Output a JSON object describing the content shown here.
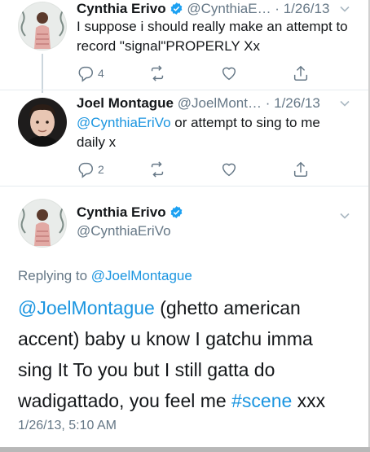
{
  "colors": {
    "link": "#1b95e0",
    "muted": "#657786",
    "verified": "#1da1f2"
  },
  "tweets": [
    {
      "name": "Cynthia Erivo",
      "verified": true,
      "handle": "@CynthiaE…",
      "date": "1/26/13",
      "text": "I suppose i should really make an attempt to record \"signal\"PROPERLY Xx",
      "replies": "4",
      "icons": [
        "reply-icon",
        "retweet-icon",
        "like-icon",
        "share-icon"
      ]
    },
    {
      "name": "Joel Montague",
      "verified": false,
      "handle": "@JoelMont…",
      "date": "1/26/13",
      "mention": "@CynthiaEriVo",
      "text": " or attempt to sing to me daily x",
      "replies": "2",
      "icons": [
        "reply-icon",
        "retweet-icon",
        "like-icon",
        "share-icon"
      ]
    }
  ],
  "main_tweet": {
    "name": "Cynthia Erivo",
    "verified": true,
    "handle": "@CynthiaEriVo",
    "replying_prefix": "Replying to ",
    "replying_to": "@JoelMontague",
    "mention": "@JoelMontague",
    "text_part1": " (ghetto american accent) baby u know I gatchu imma sing It To you but I still gatta do wadigattado, you feel me ",
    "hashtag": "#scene",
    "text_part2": " xxx",
    "timestamp": "1/26/13, 5:10 AM"
  },
  "separator": " · "
}
